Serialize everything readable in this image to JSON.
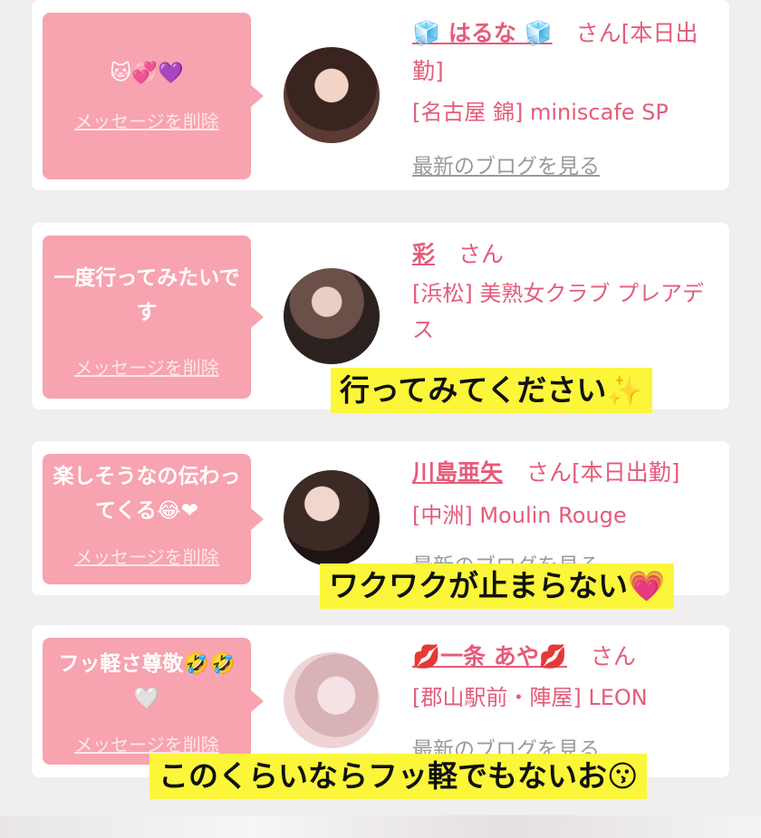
{
  "colors": {
    "bubble": "#f7a3b0",
    "link": "#e45c7a",
    "caption_bg": "#fbf63a",
    "page_bg": "#f0eeee"
  },
  "items": [
    {
      "message": "🐱💞💜",
      "delete_label": "メッセージを削除",
      "name": "🧊 はるな 🧊",
      "suffix": "さん[本日出勤]",
      "shop": "[名古屋 錦] miniscafe SP",
      "blog_label": "最新のブログを見る"
    },
    {
      "message": "一度行ってみたいです",
      "delete_label": "メッセージを削除",
      "name": "彩",
      "suffix": "さん",
      "shop": "[浜松] 美熟女クラブ プレアデス",
      "caption": "行ってみてください✨"
    },
    {
      "message": "楽しそうなの伝わってくる😂❤",
      "delete_label": "メッセージを削除",
      "name": "川島亜矢",
      "suffix": "さん[本日出勤]",
      "shop": "[中洲] Moulin Rouge",
      "blog_label": "最新のブログを見る",
      "caption": "ワクワクが止まらない💗"
    },
    {
      "message": "フッ軽さ尊敬🤣🤣🤍",
      "delete_label": "メッセージを削除",
      "name": "💋一条 あや💋",
      "suffix": "さん",
      "shop": "[郡山駅前・陣屋] LEON",
      "blog_label": "最新のブログを見る",
      "caption": "このくらいならフッ軽でもないお😗"
    }
  ]
}
